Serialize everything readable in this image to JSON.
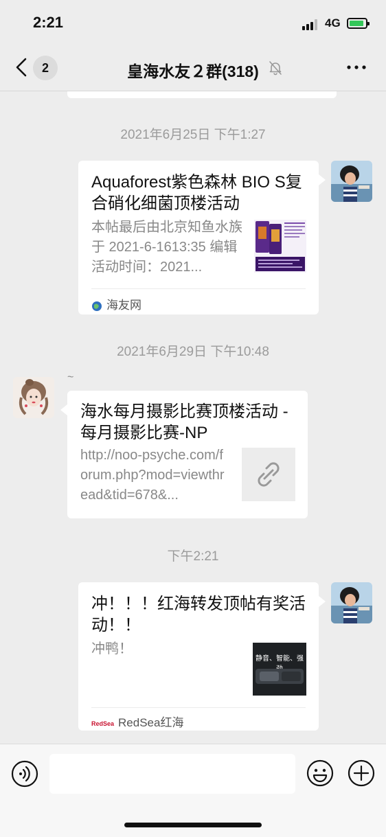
{
  "status_bar": {
    "time": "2:21",
    "network": "4G"
  },
  "nav": {
    "back_count": "2",
    "title": "皇海水友２群(318)"
  },
  "messages": {
    "ts1": "2021年6月25日 下午1:27",
    "card1": {
      "title": "Aquaforest紫色森林 BIO S复合硝化细菌顶楼活动",
      "desc": "本帖最后由北京知鱼水族于 2021-6-1613:35 编辑活动时间：2021...",
      "source": "海友网"
    },
    "ts2": "2021年6月29日 下午10:48",
    "sender_name": "~",
    "card2": {
      "title": "海水每月摄影比赛顶楼活动 - 每月摄影比赛-NP",
      "desc": "http://noo-psyche.com/forum.php?mod=viewthread&tid=678&..."
    },
    "ts3": "下午2:21",
    "card3": {
      "title": "冲！！！红海转发顶帖有奖活动！！",
      "desc": "冲鸭！",
      "thumb_text": "静音、智能、强劲",
      "source": "RedSea红海",
      "source_logo": "RedSea"
    }
  },
  "input": {
    "placeholder": ""
  },
  "colors": {
    "background": "#ededed",
    "card": "#ffffff",
    "timestamp": "#9b9b9b",
    "battery": "#34c759"
  }
}
